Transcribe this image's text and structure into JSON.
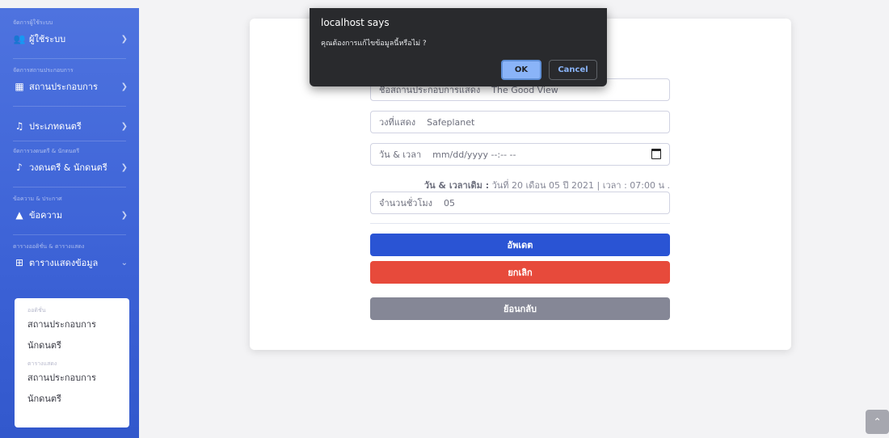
{
  "sidebar": {
    "sections": [
      {
        "heading": "จัดการผู้ใช้ระบบ",
        "item": {
          "label": "ผู้ใช้ระบบ",
          "icon": "users-icon"
        }
      },
      {
        "heading": "จัดการสถานประกอบการ",
        "item": {
          "label": "สถานประกอบการ",
          "icon": "store-icon"
        }
      },
      {
        "heading": "",
        "item": {
          "label": "ประเภทดนตรี",
          "icon": "music-icon"
        }
      },
      {
        "heading": "จัดการวงดนตรี & นักดนตรี",
        "item": {
          "label": "วงดนตรี & นักดนตรี",
          "icon": "guitar-icon"
        }
      },
      {
        "heading": "ข้อความ & ประกาศ",
        "item": {
          "label": "ข้อความ",
          "icon": "inbox-icon"
        }
      },
      {
        "heading": "ตารางออดิชั่น & ตารางแสดง",
        "item": {
          "label": "ตารางแสดงข้อมูล",
          "icon": "table-icon"
        }
      }
    ],
    "submenu": {
      "heading1": "ออดิชั่น",
      "items1": [
        "สถานประกอบการ",
        "นักดนตรี"
      ],
      "heading2": "ตารางแสดง",
      "items2": [
        "สถานประกอบการ",
        "นักดนตรี"
      ]
    }
  },
  "form": {
    "field1": {
      "label": "ชื่อสถานประกอบการแสดง",
      "value": "The Good View"
    },
    "field2": {
      "label": "วงที่แสดง",
      "value": "Safeplanet"
    },
    "field3": {
      "label": "วัน & เวลา",
      "value": "mm/dd/yyyy --:-- --"
    },
    "old_time_label": "วัน & เวลาเดิม :",
    "old_time_value": "วันที่ 20 เดือน 05 ปี 2021 | เวลา : 07:00 น .",
    "field4": {
      "label": "จำนวนชั่วโมง",
      "value": "05"
    },
    "update_button": "อัพเดต",
    "cancel_button": "ยกเลิก",
    "back_button": "ย้อนกลับ"
  },
  "dialog": {
    "title": "localhost says",
    "message": "คุณต้องการแก้ไขข้อมูลนี้หรือไม่ ?",
    "ok": "OK",
    "cancel": "Cancel"
  },
  "scroll_top_icon": "chevron-up-icon"
}
